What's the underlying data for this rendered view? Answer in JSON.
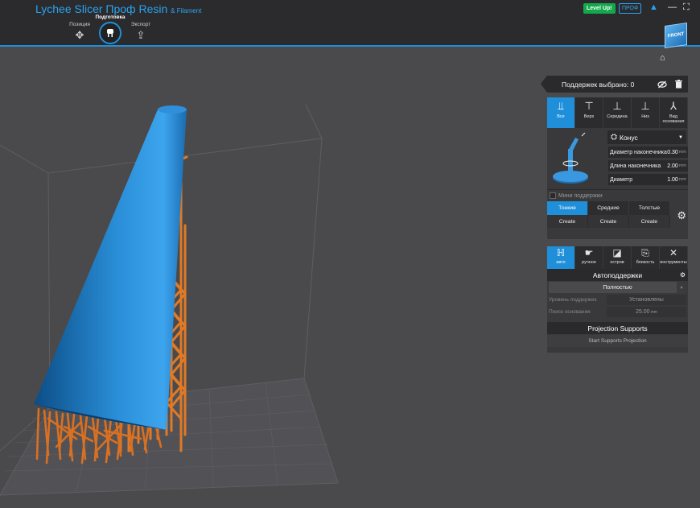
{
  "app": {
    "title": "Lychee Slicer Проф Resin",
    "title_suffix": "& Filament",
    "accent": "#1f8fd9"
  },
  "modes": [
    {
      "label": "Позиция",
      "icon": "move-icon",
      "active": false
    },
    {
      "label": "Подготовка",
      "icon": "supports-icon",
      "active": true
    },
    {
      "label": "Экспорт",
      "icon": "export-icon",
      "active": false
    }
  ],
  "header": {
    "level_up": "Level Up!",
    "prof_badge": "ПРОФ",
    "view_cube": "FRONT"
  },
  "selection": {
    "text": "Поддержек выбрано: 0"
  },
  "support_tabs": [
    {
      "label": "Все",
      "active": true
    },
    {
      "label": "Верх",
      "active": false
    },
    {
      "label": "Середина",
      "active": false
    },
    {
      "label": "Низ",
      "active": false
    },
    {
      "label": "Вид основания",
      "active": false
    }
  ],
  "support_shape": "Конус",
  "params": [
    {
      "label": "Диаметр наконечника",
      "value": "0.30",
      "unit": "mm"
    },
    {
      "label": "Длина наконечника",
      "value": "2.00",
      "unit": "mm"
    },
    {
      "label": "Диаметр",
      "value": "1.00",
      "unit": "mm"
    }
  ],
  "mini_supports": "Мини поддержки",
  "thickness": [
    {
      "label": "Тонкие",
      "active": true
    },
    {
      "label": "Средние",
      "active": false
    },
    {
      "label": "Толстые",
      "active": false
    }
  ],
  "create_label": "Create",
  "tools": [
    {
      "label": "авто",
      "active": true
    },
    {
      "label": "ручное",
      "active": false
    },
    {
      "label": "остров",
      "active": false
    },
    {
      "label": "близость",
      "active": false
    },
    {
      "label": "инструменты",
      "active": false
    }
  ],
  "auto": {
    "title": "Автоподдержки",
    "mode": "Полностью",
    "level_label": "Уровень поддержек",
    "level_value": "Установлены",
    "base_label": "Поиск основания",
    "base_value": "25.00",
    "base_unit": "mm"
  },
  "projection": {
    "title": "Projection Supports",
    "button": "Start Supports Projection"
  }
}
